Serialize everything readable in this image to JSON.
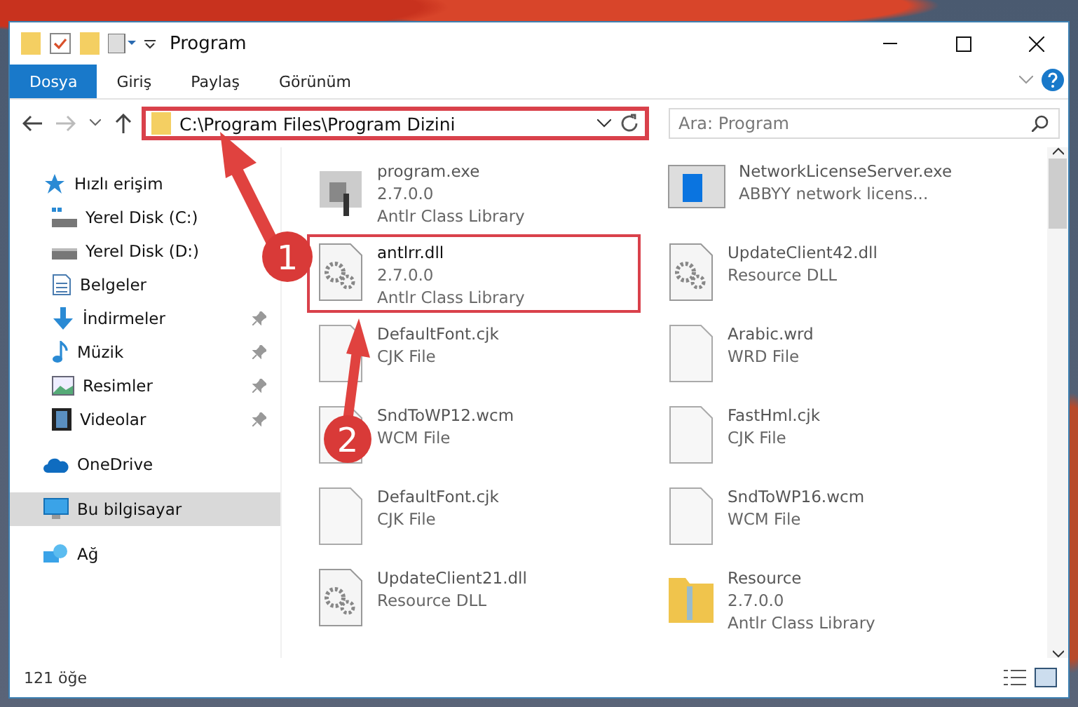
{
  "window": {
    "title": "Program"
  },
  "ribbon_tabs": [
    {
      "label": "Dosya",
      "selected": true
    },
    {
      "label": "Giriş",
      "selected": false
    },
    {
      "label": "Paylaş",
      "selected": false
    },
    {
      "label": "Görünüm",
      "selected": false
    }
  ],
  "address": {
    "value": "C:\\Program Files\\Program Dizini",
    "highlighted": true
  },
  "search": {
    "placeholder": "Ara: Program"
  },
  "sidebar": {
    "items": [
      {
        "label": "Hızlı erişim",
        "kind": "star",
        "selected": false,
        "children": [
          {
            "label": "Yerel Disk (C:)",
            "kind": "drive-c",
            "pinned": false,
            "selected": false
          },
          {
            "label": "Yerel Disk (D:)",
            "kind": "drive",
            "pinned": false,
            "selected": false
          },
          {
            "label": "Belgeler",
            "kind": "doc",
            "pinned": false,
            "selected": false
          },
          {
            "label": "İndirmeler",
            "kind": "download",
            "pinned": true,
            "selected": false
          },
          {
            "label": "Müzik",
            "kind": "music",
            "pinned": true,
            "selected": false
          },
          {
            "label": "Resimler",
            "kind": "image",
            "pinned": true,
            "selected": false
          },
          {
            "label": "Videolar",
            "kind": "video",
            "pinned": true,
            "selected": false
          }
        ]
      },
      {
        "label": "OneDrive",
        "kind": "cloud",
        "selected": false
      },
      {
        "label": "Bu bilgisayar",
        "kind": "pc",
        "selected": true
      },
      {
        "label": "Ağ",
        "kind": "network",
        "selected": false
      }
    ]
  },
  "files": [
    {
      "name": "program.exe",
      "lines": [
        "2.7.0.0",
        "Antlr Class Library"
      ],
      "kind": "app",
      "blurred": true,
      "highlighted": false
    },
    {
      "name": "NetworkLicenseServer.exe",
      "lines": [
        "ABBYY network licens..."
      ],
      "kind": "window",
      "blurred": true,
      "highlighted": false
    },
    {
      "name": "antlrr.dll",
      "lines": [
        "2.7.0.0",
        "Antlr Class Library"
      ],
      "kind": "dll",
      "blurred": false,
      "highlighted": true
    },
    {
      "name": "UpdateClient42.dll",
      "lines": [
        "Resource DLL"
      ],
      "kind": "dll",
      "blurred": true,
      "highlighted": false
    },
    {
      "name": "DefaultFont.cjk",
      "lines": [
        "CJK File"
      ],
      "kind": "file",
      "blurred": true,
      "highlighted": false
    },
    {
      "name": "Arabic.wrd",
      "lines": [
        "WRD File"
      ],
      "kind": "file",
      "blurred": true,
      "highlighted": false
    },
    {
      "name": "SndToWP12.wcm",
      "lines": [
        "WCM File"
      ],
      "kind": "file",
      "blurred": true,
      "highlighted": false
    },
    {
      "name": "FastHml.cjk",
      "lines": [
        "CJK File"
      ],
      "kind": "file",
      "blurred": true,
      "highlighted": false
    },
    {
      "name": "DefaultFont.cjk",
      "lines": [
        "CJK File"
      ],
      "kind": "file",
      "blurred": true,
      "highlighted": false
    },
    {
      "name": "SndToWP16.wcm",
      "lines": [
        "WCM File"
      ],
      "kind": "file",
      "blurred": true,
      "highlighted": false
    },
    {
      "name": "UpdateClient21.dll",
      "lines": [
        "Resource DLL"
      ],
      "kind": "dll",
      "blurred": true,
      "highlighted": false
    },
    {
      "name": "Resource",
      "lines": [
        "2.7.0.0",
        "Antlr Class Library"
      ],
      "kind": "folder",
      "blurred": true,
      "highlighted": false
    }
  ],
  "status_bar": {
    "count": "121 öğe"
  },
  "annotations": [
    {
      "label": "1"
    },
    {
      "label": "2"
    }
  ]
}
